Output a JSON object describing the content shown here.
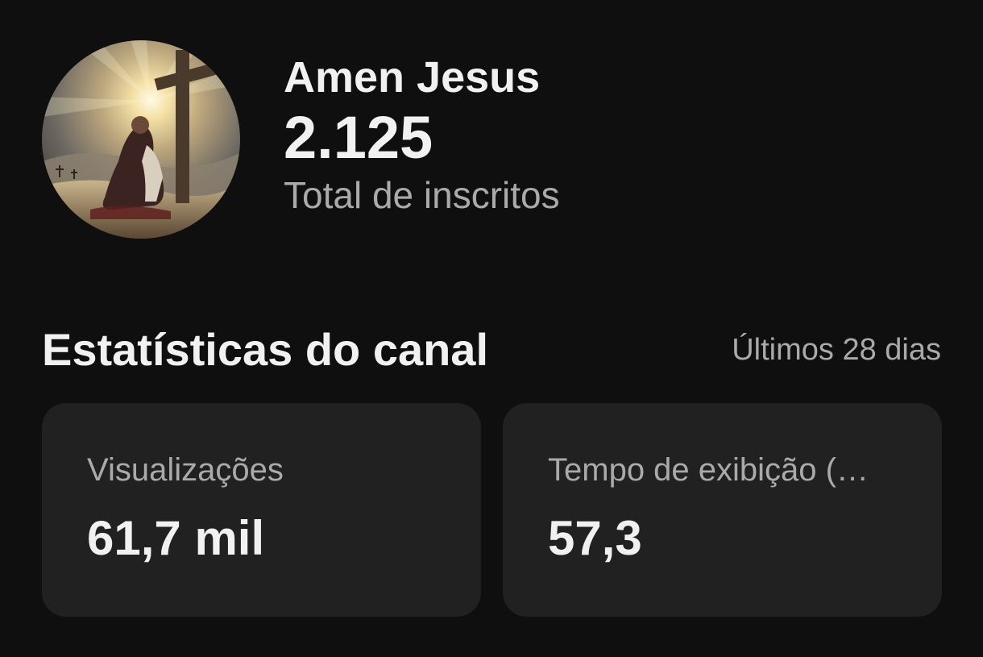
{
  "channel": {
    "name": "Amen Jesus",
    "subscriber_count": "2.125",
    "subscriber_label": "Total de inscritos"
  },
  "stats": {
    "title": "Estatísticas do canal",
    "period": "Últimos 28 dias",
    "cards": [
      {
        "label": "Visualizações",
        "value": "61,7 mil"
      },
      {
        "label": "Tempo de exibição (…",
        "value": "57,3"
      }
    ]
  },
  "colors": {
    "background": "#0f0f0f",
    "card_background": "#212121",
    "primary_text": "#f1f1f1",
    "secondary_text": "#aaaaaa"
  }
}
